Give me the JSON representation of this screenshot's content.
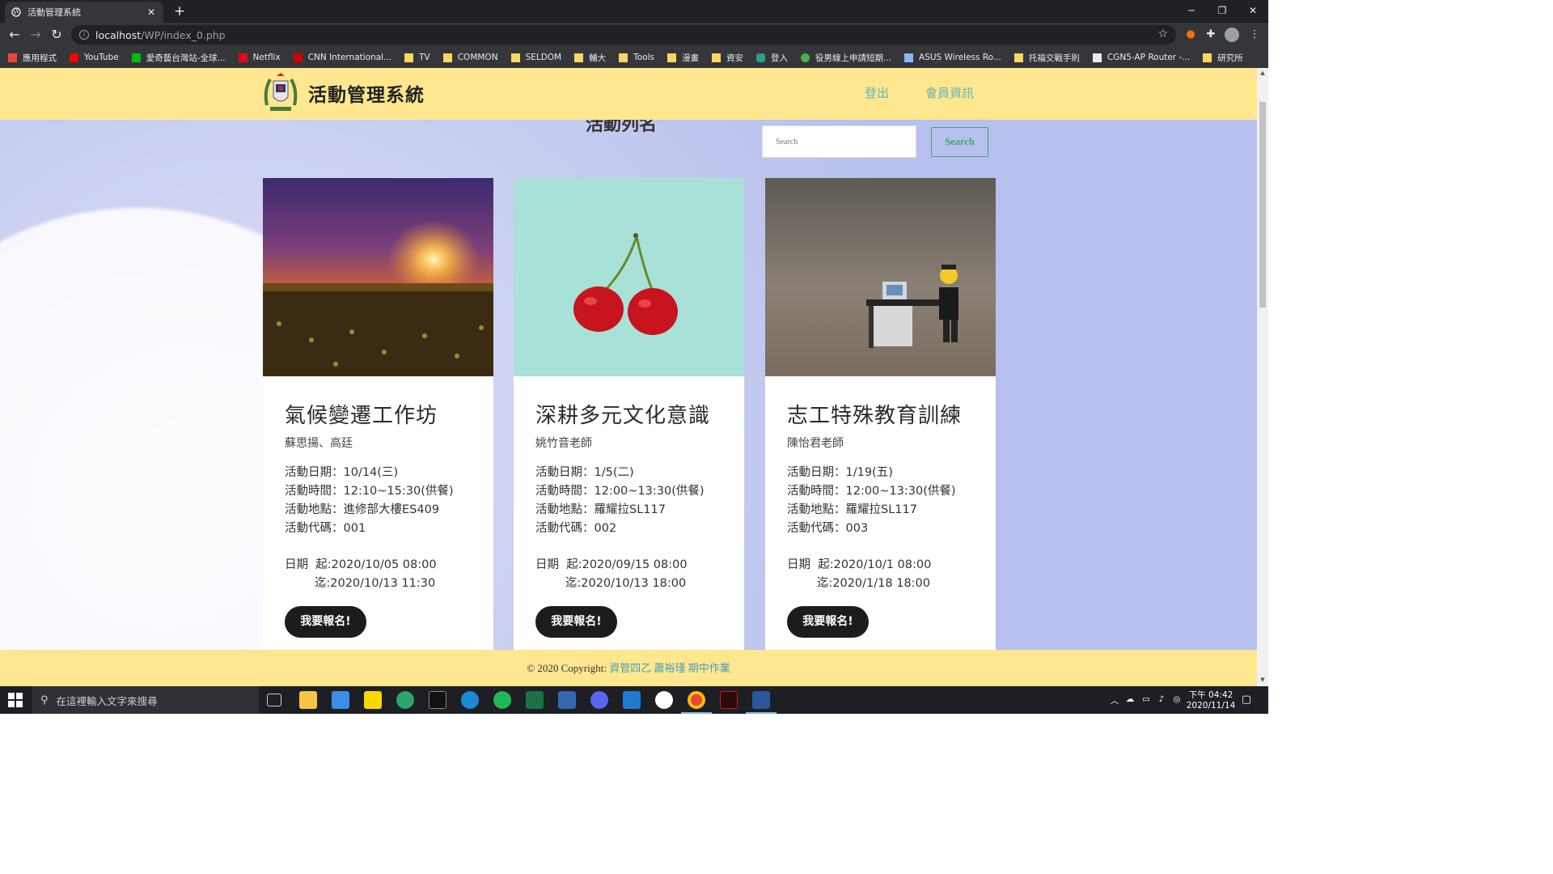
{
  "browser": {
    "tab_title": "活動管理系統",
    "tab_close": "✕",
    "new_tab": "+",
    "url_host": "localhost",
    "url_path": "/WP/index_0.php",
    "window_controls": [
      "─",
      "❐",
      "✕"
    ],
    "bookmarks": [
      {
        "label": "應用程式",
        "icon": "apps-grid-icon",
        "color": "#e8453c"
      },
      {
        "label": "YouTube",
        "icon": "youtube-icon",
        "color": "#ff0000"
      },
      {
        "label": "愛奇藝台灣站-全球...",
        "icon": "iqiyi-icon",
        "color": "#00be06"
      },
      {
        "label": "Netflix",
        "icon": "netflix-icon",
        "color": "#e50914"
      },
      {
        "label": "CNN International...",
        "icon": "cnn-icon",
        "color": "#cc0000"
      },
      {
        "label": "TV",
        "icon": "folder-icon",
        "color": "#fdd663"
      },
      {
        "label": "COMMON",
        "icon": "folder-icon",
        "color": "#fdd663"
      },
      {
        "label": "SELDOM",
        "icon": "folder-icon",
        "color": "#fdd663"
      },
      {
        "label": "輔大",
        "icon": "folder-icon",
        "color": "#fdd663"
      },
      {
        "label": "Tools",
        "icon": "folder-icon",
        "color": "#fdd663"
      },
      {
        "label": "漫畫",
        "icon": "folder-icon",
        "color": "#fdd663"
      },
      {
        "label": "資安",
        "icon": "folder-icon",
        "color": "#fdd663"
      },
      {
        "label": "登入",
        "icon": "login-icon",
        "color": "#2a9d8f"
      },
      {
        "label": "役男線上申請短期...",
        "icon": "gov-icon",
        "color": "#4caf50"
      },
      {
        "label": "ASUS Wireless Ro...",
        "icon": "wifi-icon",
        "color": "#8ab4f8"
      },
      {
        "label": "托福交戰手則",
        "icon": "folder-icon",
        "color": "#fdd663"
      },
      {
        "label": "CGN5-AP Router -...",
        "icon": "router-icon",
        "color": "#e8eaed"
      },
      {
        "label": "研究所",
        "icon": "folder-icon",
        "color": "#fdd663"
      }
    ]
  },
  "site": {
    "title": "活動管理系統",
    "nav": {
      "logout": "登出",
      "member_info": "會員資訊"
    },
    "heading_partial": "活動列名",
    "search_placeholder": "Search",
    "search_button": "Search",
    "footer": {
      "prefix": "© 2020 Copyright: ",
      "link_text": "資管四乙 蕭裕瑾 期中作業"
    },
    "accent_color": "#fee78e"
  },
  "cards": [
    {
      "image": "sunset-field-photo",
      "title": "氣候變遷工作坊",
      "speaker": "蘇思揚、高廷",
      "date": "活動日期：10/14(三)",
      "time": "活動時間：12:10~15:30(供餐)",
      "place": "活動地點：進修部大樓ES409",
      "code": "活動代碼：001",
      "period_start": "日期  起:2020/10/05 08:00",
      "period_end": "        迄:2020/10/13 11:30",
      "button": "我要報名!"
    },
    {
      "image": "cherries-photo",
      "title": "深耕多元文化意識",
      "speaker": "姚竹音老師",
      "date": "活動日期：1/5(二)",
      "time": "活動時間：12:00~13:30(供餐)",
      "place": "活動地點：羅耀拉SL117",
      "code": "活動代碼：002",
      "period_start": "日期  起:2020/09/15 08:00",
      "period_end": "        迄:2020/10/13 18:00",
      "button": "我要報名!"
    },
    {
      "image": "lego-office-photo",
      "title": "志工特殊教育訓練",
      "speaker": "陳怡君老師",
      "date": "活動日期：1/19(五)",
      "time": "活動時間：12:00~13:30(供餐)",
      "place": "活動地點：羅耀拉SL117",
      "code": "活動代碼：003",
      "period_start": "日期  起:2020/10/1 08:00",
      "period_end": "        迄:2020/1/18 18:00",
      "button": "我要報名!"
    }
  ],
  "taskbar": {
    "search_placeholder": "在這裡輸入文字來搜尋",
    "clock_time": "下午 04:42",
    "clock_date": "2020/11/14"
  }
}
